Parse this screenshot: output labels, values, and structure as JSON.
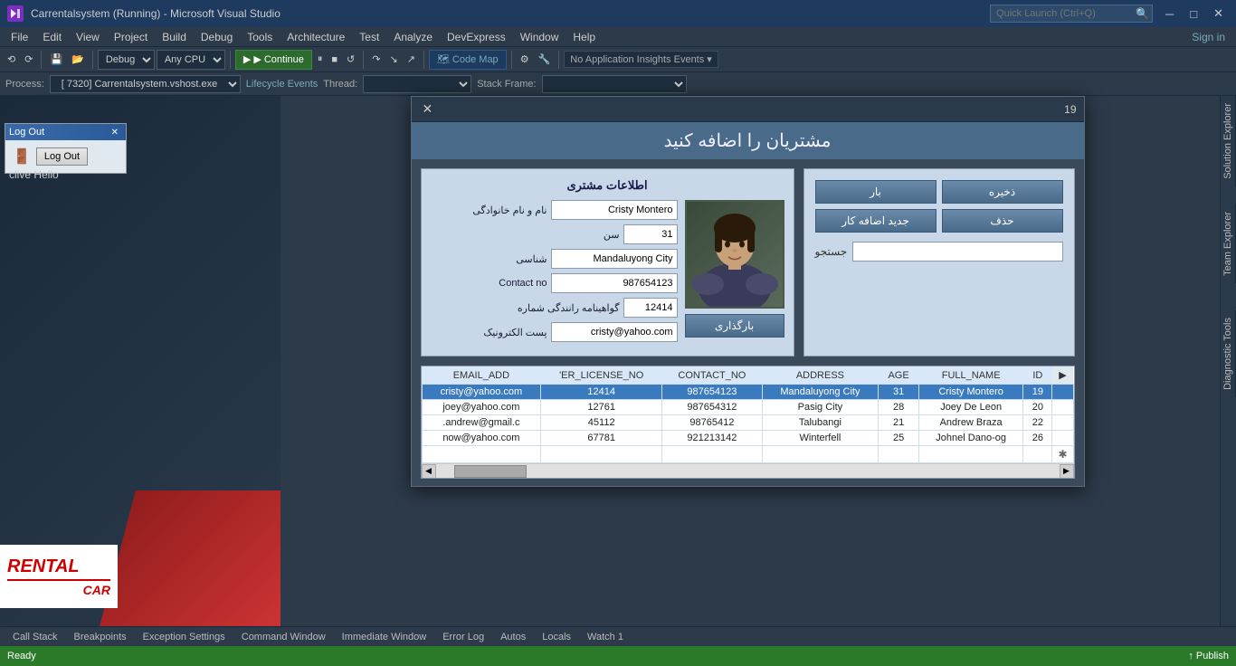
{
  "titlebar": {
    "logo": "VS",
    "title": "Carrentalsystem (Running) - Microsoft Visual Studio",
    "search_placeholder": "Quick Launch (Ctrl+Q)",
    "btn_minimize": "─",
    "btn_maximize": "□",
    "btn_close": "✕"
  },
  "menubar": {
    "items": [
      "File",
      "Edit",
      "View",
      "Project",
      "Build",
      "Debug",
      "Tools",
      "Architecture",
      "Test",
      "Analyze",
      "DevExpress",
      "Window",
      "Help"
    ]
  },
  "toolbar": {
    "debug_mode": "Debug",
    "cpu": "Any CPU",
    "continue_label": "▶ Continue",
    "code_map": "🗺 Code Map",
    "no_insights": "No Application Insights Events ▾"
  },
  "processbar": {
    "process_label": "Process:",
    "process_value": "[7320] Carrentalsystem.vshost.exe",
    "lifecycle_label": "Lifecycle Events",
    "thread_label": "Thread:",
    "stack_label": "Stack Frame:"
  },
  "dialog": {
    "id": "19",
    "close_btn": "✕",
    "title": "مشتریان را اضافه کنید",
    "btn_save": "ذخیره",
    "btn_load": "بار",
    "btn_delete": "حذف",
    "btn_new": "جدید اضافه کار",
    "btn_search": "جستجو",
    "btn_upload": "بارگذاری",
    "customer_info_label": "اطلاعات مشتری",
    "field_name_label": "نام و نام خانوادگی",
    "field_age_label": "سن",
    "field_city_label": "شناسی",
    "field_contact_label": "Contact no",
    "field_license_label": "گواهینامه رانندگی شماره",
    "field_email_label": "پست الکترونیک",
    "field_name_value": "Cristy Montero",
    "field_age_value": "31",
    "field_city_value": "Mandaluyong City",
    "field_contact_value": "987654123",
    "field_license_value": "12414",
    "field_email_value": "cristy@yahoo.com"
  },
  "table": {
    "columns": [
      "EMAIL_ADD",
      "'ER_LICENSE_NO",
      "CONTACT_NO",
      "ADDRESS",
      "AGE",
      "FULL_NAME",
      "ID"
    ],
    "rows": [
      {
        "email": "cristy@yahoo.com",
        "license": "12414",
        "contact": "987654123",
        "address": "Mandaluyong City",
        "age": "31",
        "name": "Cristy Montero",
        "id": "19",
        "selected": true
      },
      {
        "email": "joey@yahoo.com",
        "license": "12761",
        "contact": "987654312",
        "address": "Pasig City",
        "age": "28",
        "name": "Joey De Leon",
        "id": "20",
        "selected": false
      },
      {
        "email": ".andrew@gmail.c",
        "license": "45112",
        "contact": "98765412",
        "address": "Talubangi",
        "age": "21",
        "name": "Andrew Braza",
        "id": "22",
        "selected": false
      },
      {
        "email": "now@yahoo.com",
        "license": "67781",
        "contact": "921213142",
        "address": "Winterfell",
        "age": "25",
        "name": "Johnel Dano-og",
        "id": "26",
        "selected": false
      }
    ]
  },
  "left_panel": {
    "logout_title": "Log Out",
    "logout_btn": "Log Out",
    "user_text": "clive  Hello",
    "rental_line1": "RENTAL",
    "rental_line2": "CAR"
  },
  "right_side": {
    "solution_explorer": "Solution Explorer",
    "team_explorer": "Team Explorer",
    "diagnostic_tools": "Diagnostic Tools"
  },
  "bottom_tabs": {
    "items": [
      "Call Stack",
      "Breakpoints",
      "Exception Settings",
      "Command Window",
      "Immediate Window",
      "Error Log",
      "Autos",
      "Locals",
      "Watch 1"
    ]
  },
  "statusbar": {
    "ready": "Ready",
    "publish": "↑ Publish"
  }
}
